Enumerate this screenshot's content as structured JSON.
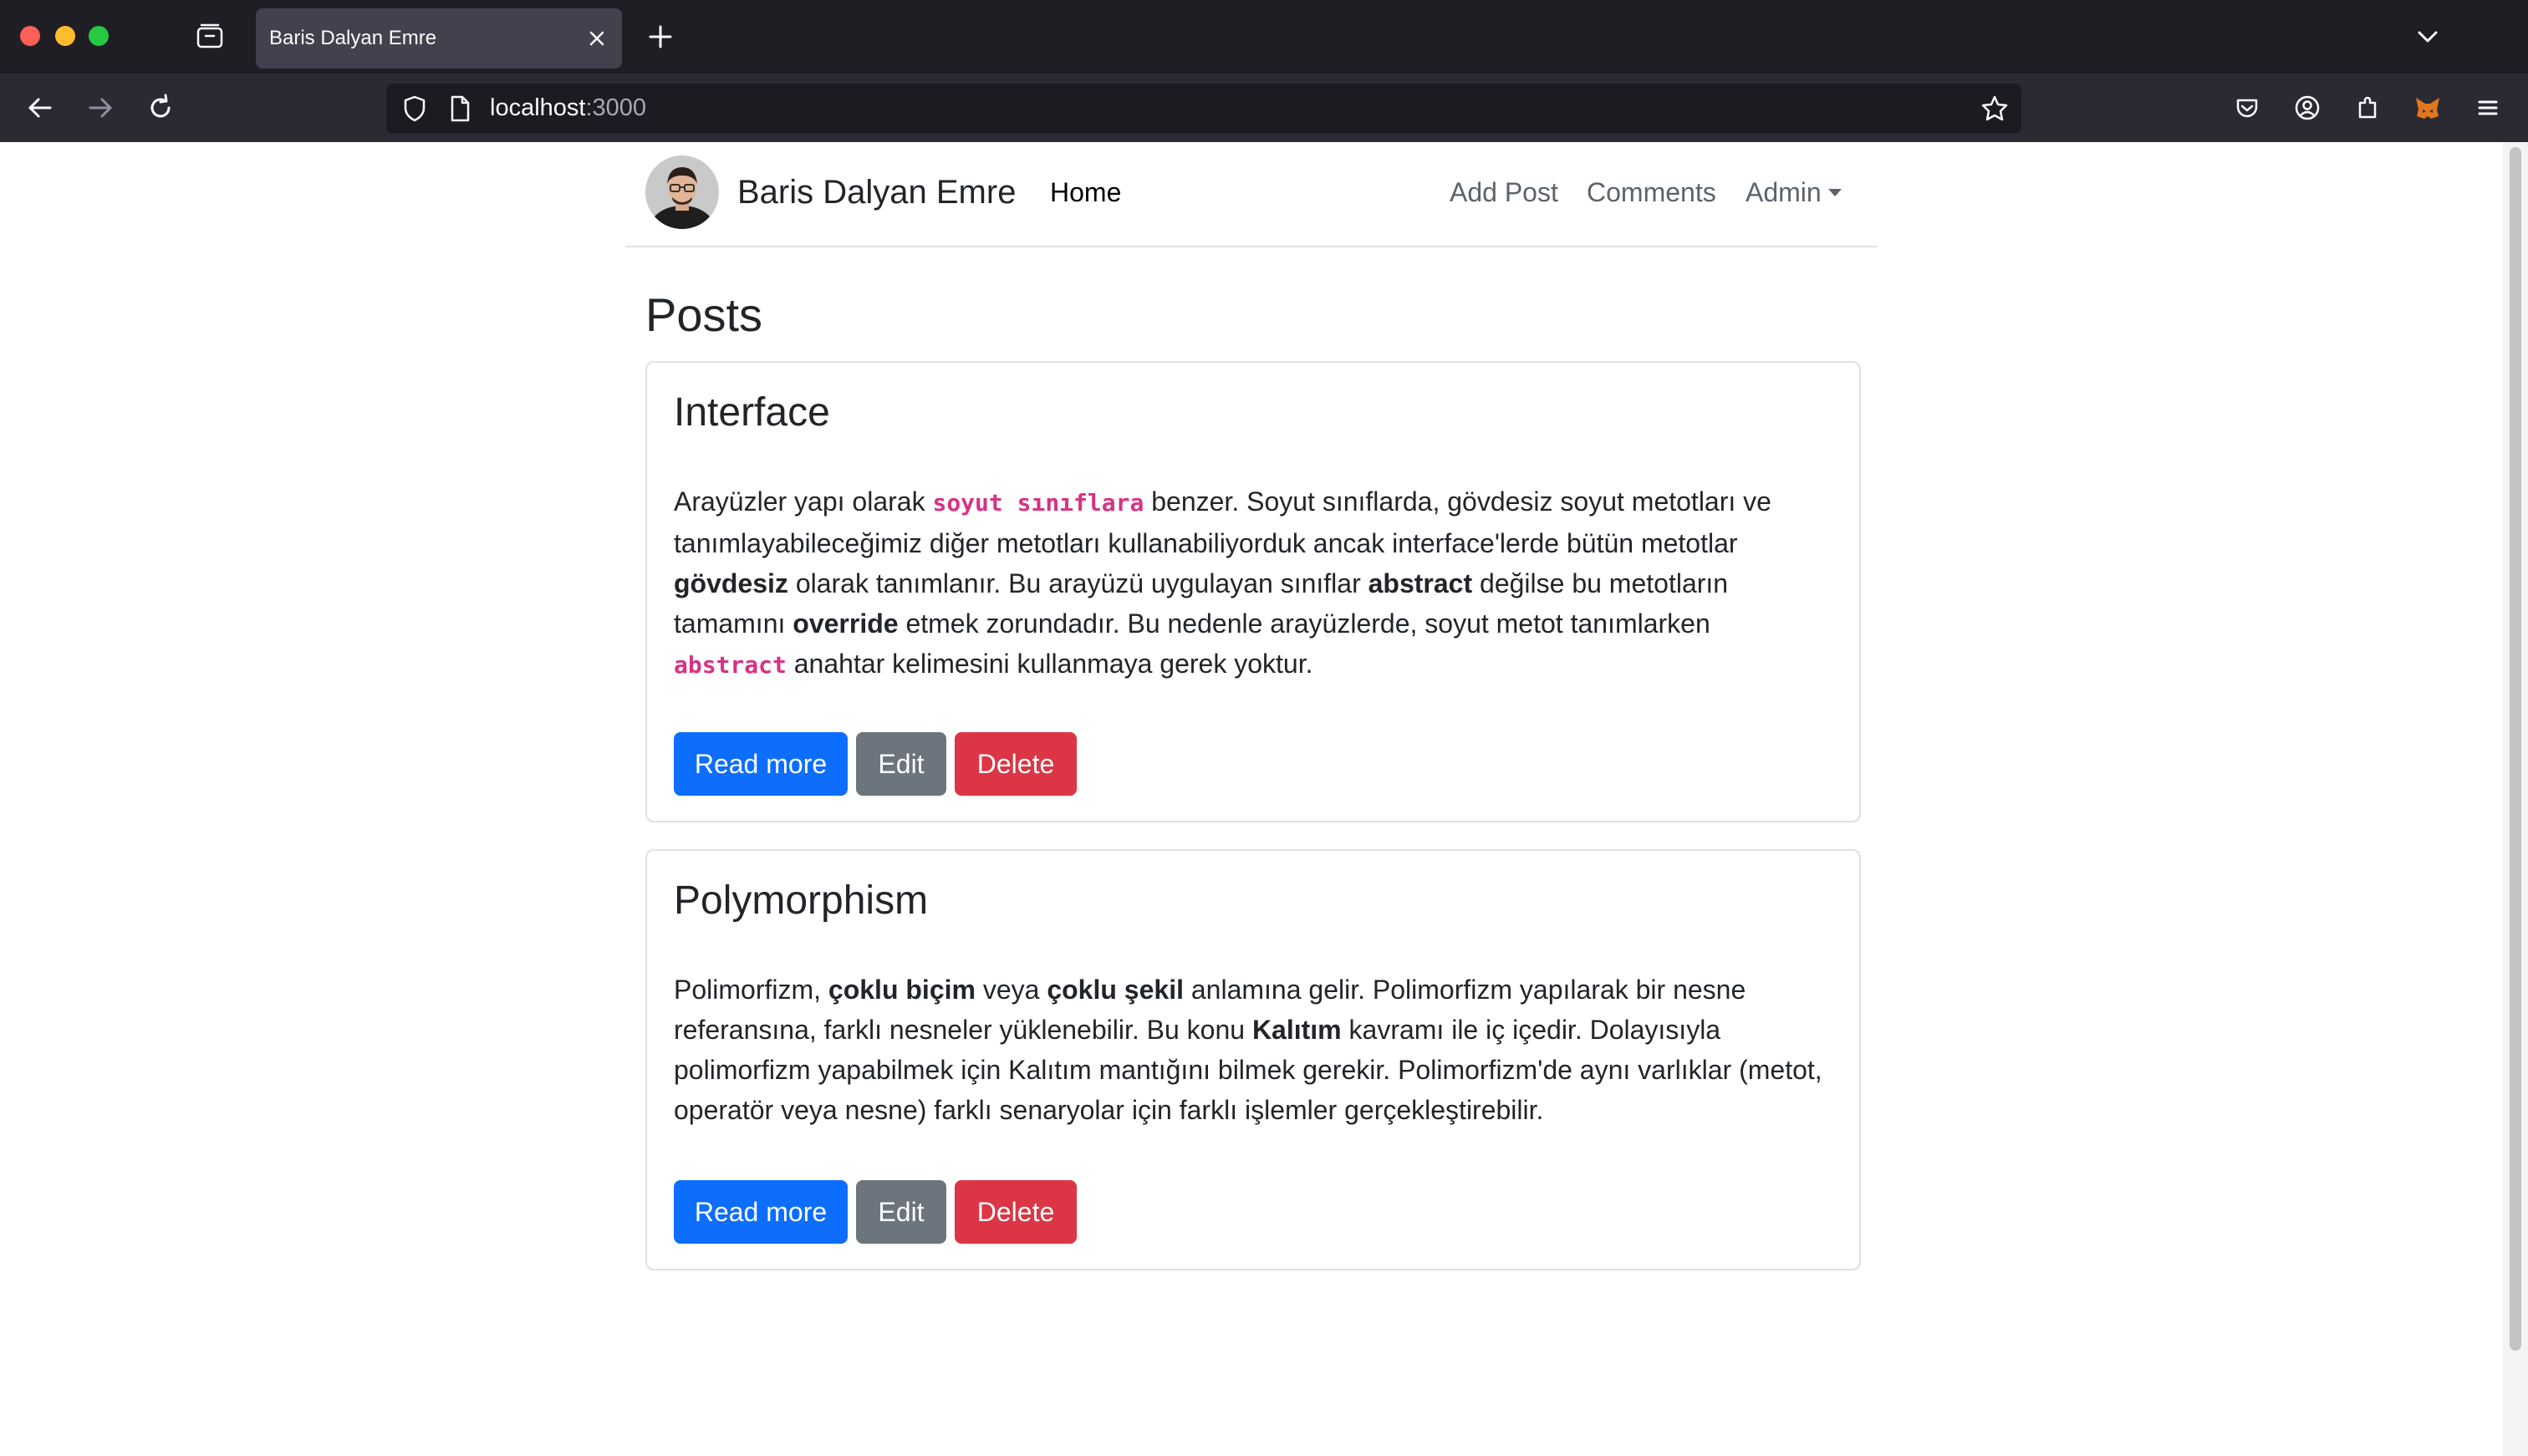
{
  "browser": {
    "tab_title": "Baris Dalyan Emre",
    "url_host": "localhost",
    "url_port": ":3000"
  },
  "site": {
    "brand": "Baris Dalyan Emre",
    "nav": {
      "home": "Home",
      "add_post": "Add Post",
      "comments": "Comments",
      "admin": "Admin"
    }
  },
  "main": {
    "heading": "Posts",
    "posts": [
      {
        "title": "Interface",
        "body_parts": [
          "Arayüzler yapı olarak ",
          "soyut sınıflara",
          " benzer. Soyut sınıflarda, gövdesiz soyut metotları ve tanımlayabileceğimiz diğer metotları kullanabiliyorduk ancak interface'lerde bütün metotlar ",
          "gövdesiz",
          " olarak tanımlanır. Bu arayüzü uygulayan sınıflar ",
          "abstract",
          " değilse bu metotların tamamını ",
          "override",
          " etmek zorundadır. Bu nedenle arayüzlerde, soyut metot tanımlarken ",
          "abstract",
          " anahtar kelimesini kullanmaya gerek yoktur."
        ],
        "read_more": "Read more",
        "edit": "Edit",
        "delete": "Delete"
      },
      {
        "title": "Polymorphism",
        "body_parts": [
          "Polimorfizm, ",
          "çoklu biçim",
          " veya ",
          "çoklu şekil",
          " anlamına gelir. Polimorfizm yapılarak bir nesne referansına, farklı nesneler yüklenebilir. Bu konu ",
          "Kalıtım",
          " kavramı ile iç içedir. Dolayısıyla polimorfizm yapabilmek için Kalıtım mantığını bilmek gerekir. Polimorfizm'de aynı varlıklar (metot, operatör veya nesne) farklı senaryolar için farklı işlemler gerçekleştirebilir."
        ],
        "read_more": "Read more",
        "edit": "Edit",
        "delete": "Delete"
      }
    ]
  },
  "colors": {
    "primary": "#0d6efd",
    "secondary": "#6c757d",
    "danger": "#dc3545",
    "code": "#d63384"
  }
}
